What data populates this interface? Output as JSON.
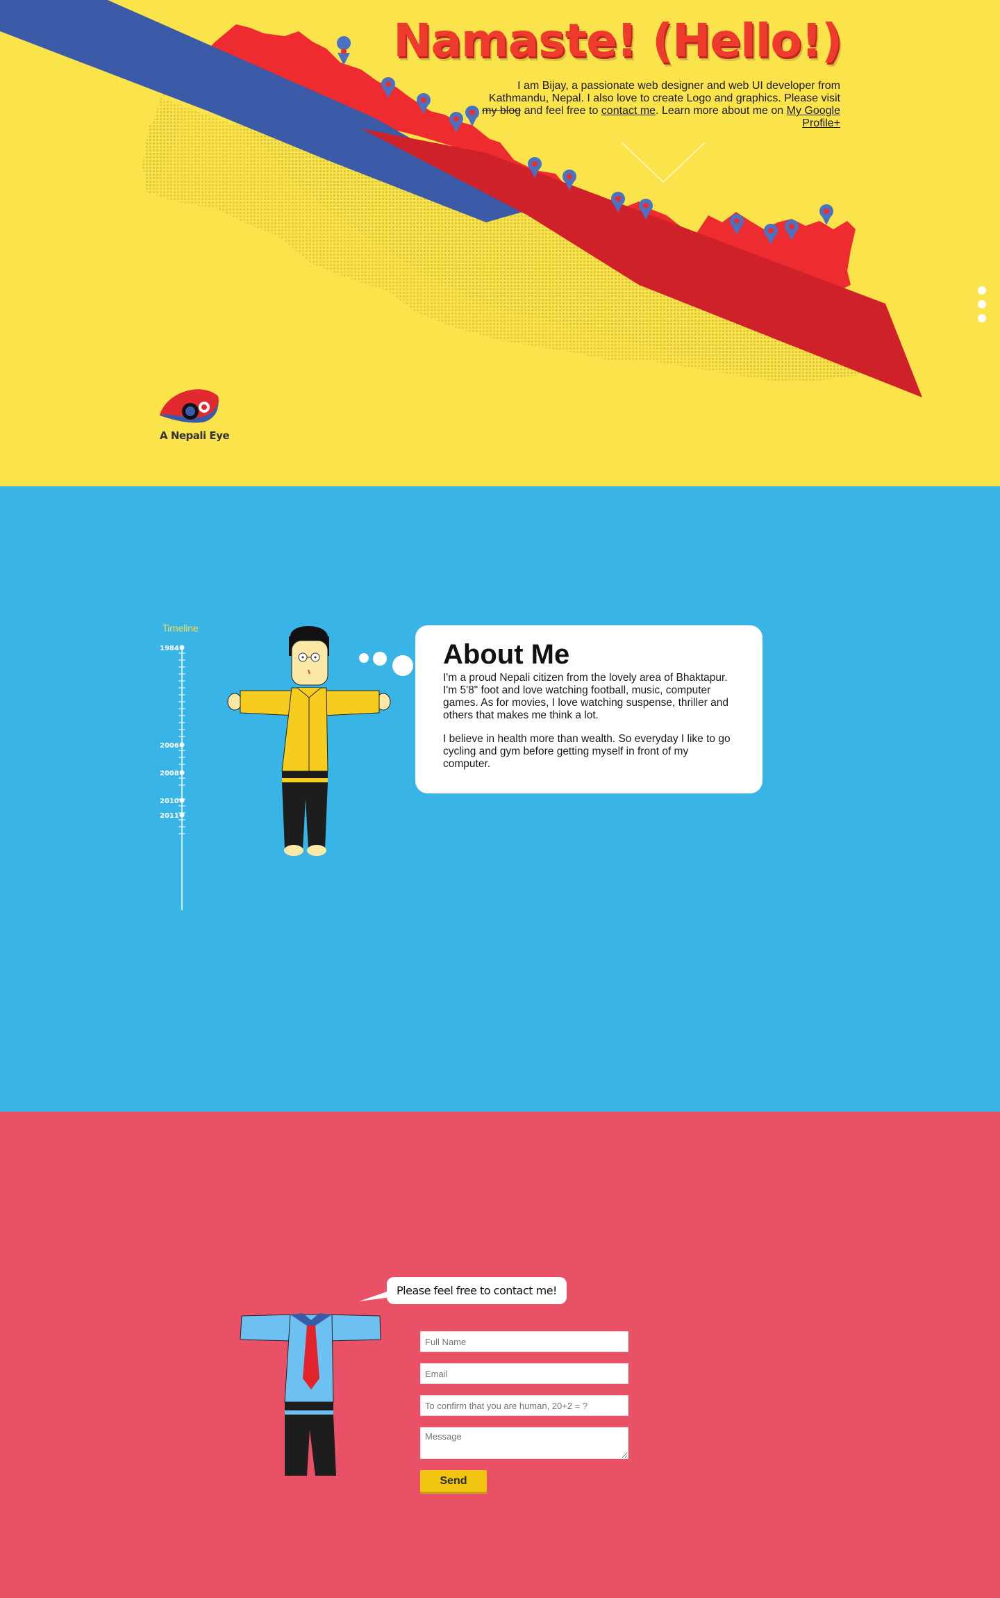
{
  "hero": {
    "title": "Namaste! (Hello!)",
    "intro_part1": "I am Bijay, a passionate web designer and web UI developer from Kathmandu, Nepal. I also love to create Logo and graphics. Please visit ",
    "blog_link": "my blog",
    "intro_part2": " and feel free to ",
    "contact_link": "contact me",
    "intro_part3": ". Learn more about me on ",
    "profile_link": "My Google Profile+",
    "logo_label": "A Nepali Eye",
    "colors": {
      "background": "#fbe34b",
      "map_red": "#ee2b2e",
      "blue_band": "#3b5ba8",
      "pin_blue": "#4a72c2"
    }
  },
  "page_nav": {
    "dots": [
      "section-1",
      "section-2",
      "section-3"
    ]
  },
  "about": {
    "timeline_label": "Timeline",
    "timeline_years": [
      "1984",
      "2006",
      "2008",
      "2010",
      "2011"
    ],
    "title": "About Me",
    "paragraph1": "I'm a proud Nepali citizen from the lovely area of Bhaktapur. I'm 5'8\" foot and love watching football, music, computer games. As for movies, I love watching suspense, thriller and others that makes me think a lot.",
    "paragraph2": "I believe in health more than wealth. So everyday I like to go cycling and gym before getting myself in front of my computer.",
    "colors": {
      "background": "#38b5e6",
      "shirt": "#f6cc1f",
      "pants": "#1d1d1d"
    }
  },
  "contact": {
    "speech": "Please feel free to contact me!",
    "fields": {
      "name_placeholder": "Full Name",
      "email_placeholder": "Email",
      "captcha_placeholder": "To confirm that you are human, 20+2 = ?",
      "message_placeholder": "Message"
    },
    "send_label": "Send",
    "colors": {
      "background": "#e85166",
      "shirt": "#6cc0f2",
      "tie": "#e2232b",
      "button": "#f1c40f"
    }
  }
}
